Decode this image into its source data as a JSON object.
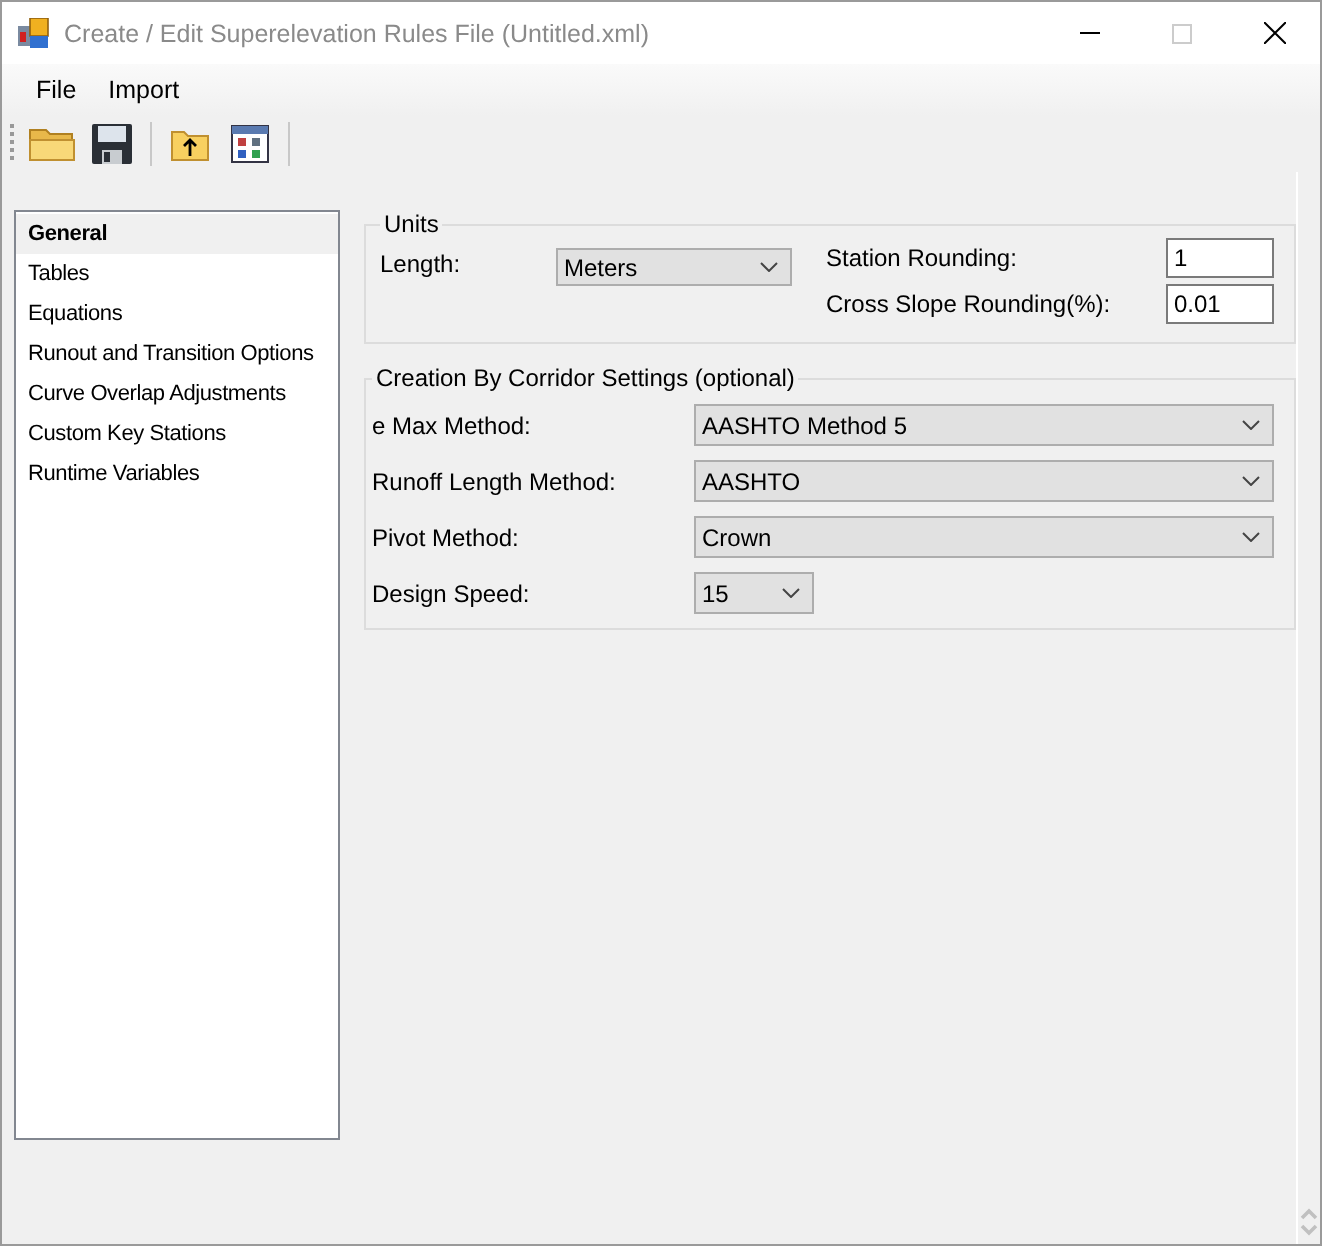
{
  "window": {
    "title": "Create / Edit Superelevation Rules File (Untitled.xml)"
  },
  "menu": [
    "File",
    "Import"
  ],
  "sidebar": {
    "items": [
      {
        "label": "General",
        "selected": true
      },
      {
        "label": "Tables",
        "selected": false
      },
      {
        "label": "Equations",
        "selected": false
      },
      {
        "label": "Runout and Transition Options",
        "selected": false
      },
      {
        "label": "Curve Overlap Adjustments",
        "selected": false
      },
      {
        "label": "Custom Key Stations",
        "selected": false
      },
      {
        "label": "Runtime Variables",
        "selected": false
      }
    ]
  },
  "units": {
    "title": "Units",
    "length": {
      "label": "Length:",
      "value": "Meters"
    },
    "station_rounding": {
      "label": "Station Rounding:",
      "value": "1"
    },
    "cross_slope_rounding": {
      "label": "Cross Slope Rounding(%):",
      "value": "0.01"
    }
  },
  "corridor": {
    "title": "Creation By Corridor Settings (optional)",
    "fields": [
      {
        "label": "e Max Method:",
        "value": "AASHTO Method 5",
        "wide": true
      },
      {
        "label": "Runoff Length Method:",
        "value": "AASHTO",
        "wide": true
      },
      {
        "label": "Pivot Method:",
        "value": "Crown",
        "wide": true
      },
      {
        "label": "Design Speed:",
        "value": "15",
        "wide": false
      }
    ]
  }
}
